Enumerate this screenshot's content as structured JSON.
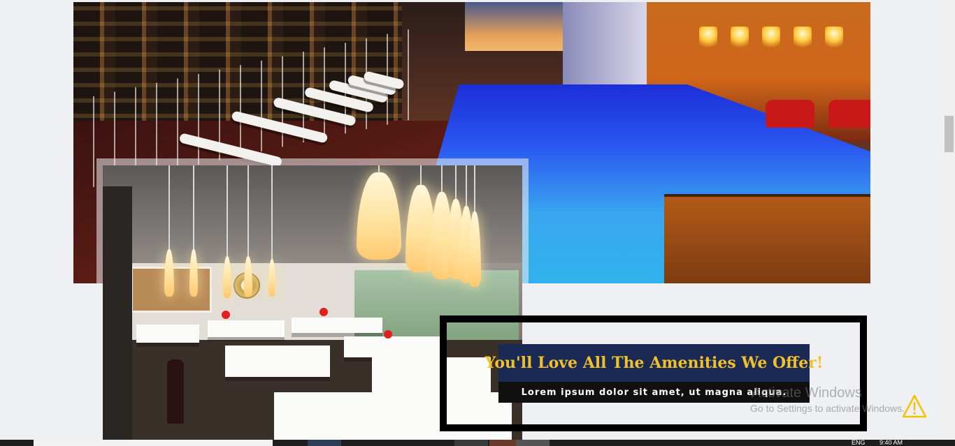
{
  "promo": {
    "title": "You'll Love All The Amenities We Offer!",
    "subtitle": "Lorem ipsum dolor sit amet, ut magna aliqua."
  },
  "watermark": {
    "title": "Activate Windows",
    "subtitle": "Go to Settings to activate Windows."
  },
  "taskbar": {
    "language": "ENG",
    "time": "9:40 AM"
  },
  "colors": {
    "page_bg": "#eef0f4",
    "promo_title_bg": "#1a2a55",
    "promo_title_text": "#f2c12a",
    "promo_border": "#000000"
  },
  "icons": [
    "warning-icon",
    "search-icon",
    "windows-start-icon"
  ]
}
